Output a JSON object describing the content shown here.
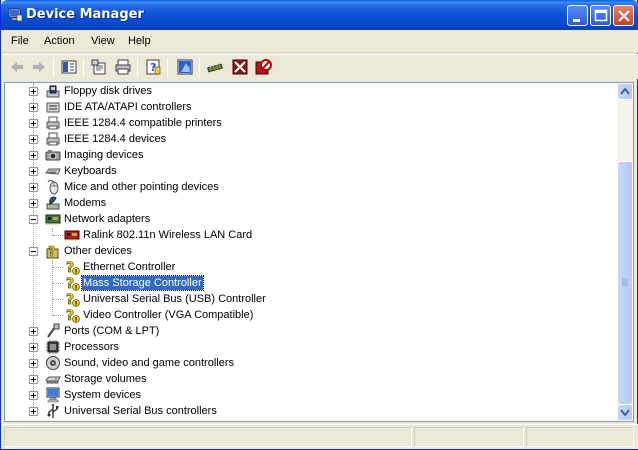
{
  "window": {
    "title": "Device Manager"
  },
  "title_buttons": {
    "minimize": "minimize",
    "maximize": "maximize",
    "close": "close"
  },
  "menu": [
    "File",
    "Action",
    "View",
    "Help"
  ],
  "toolbar": {
    "icons": [
      "back-icon",
      "forward-icon",
      "show-hide-console-tree-icon",
      "properties-icon",
      "print-icon",
      "help-icon",
      "computer-icon",
      "scan-hardware-icon",
      "uninstall-icon",
      "disable-icon"
    ]
  },
  "tree": {
    "items": [
      {
        "label": "Floppy disk drives",
        "icon": "floppy-icon",
        "level": 0,
        "expanded": false
      },
      {
        "label": "IDE ATA/ATAPI controllers",
        "icon": "ide-icon",
        "level": 0,
        "expanded": false
      },
      {
        "label": "IEEE 1284.4 compatible printers",
        "icon": "printer-icon",
        "level": 0,
        "expanded": false
      },
      {
        "label": "IEEE 1284.4 devices",
        "icon": "printer-icon",
        "level": 0,
        "expanded": false
      },
      {
        "label": "Imaging devices",
        "icon": "camera-icon",
        "level": 0,
        "expanded": false
      },
      {
        "label": "Keyboards",
        "icon": "keyboard-icon",
        "level": 0,
        "expanded": false
      },
      {
        "label": "Mice and other pointing devices",
        "icon": "mouse-icon",
        "level": 0,
        "expanded": false
      },
      {
        "label": "Modems",
        "icon": "modem-icon",
        "level": 0,
        "expanded": false
      },
      {
        "label": "Network adapters",
        "icon": "network-card-icon",
        "level": 0,
        "expanded": true
      },
      {
        "label": "Ralink 802.11n Wireless LAN Card",
        "icon": "network-card-icon",
        "level": 1
      },
      {
        "label": "Other devices",
        "icon": "unknown-device-icon",
        "level": 0,
        "expanded": true
      },
      {
        "label": "Ethernet Controller",
        "icon": "warning-unknown-icon",
        "level": 1
      },
      {
        "label": "Mass Storage Controller",
        "icon": "warning-unknown-icon",
        "level": 1,
        "selected": true
      },
      {
        "label": "Universal Serial Bus (USB) Controller",
        "icon": "warning-unknown-icon",
        "level": 1
      },
      {
        "label": "Video Controller (VGA Compatible)",
        "icon": "warning-unknown-icon",
        "level": 1
      },
      {
        "label": "Ports (COM & LPT)",
        "icon": "port-icon",
        "level": 0,
        "expanded": false
      },
      {
        "label": "Processors",
        "icon": "processor-icon",
        "level": 0,
        "expanded": false
      },
      {
        "label": "Sound, video and game controllers",
        "icon": "sound-icon",
        "level": 0,
        "expanded": false
      },
      {
        "label": "Storage volumes",
        "icon": "storage-icon",
        "level": 0,
        "expanded": false
      },
      {
        "label": "System devices",
        "icon": "system-icon",
        "level": 0,
        "expanded": false
      },
      {
        "label": "Universal Serial Bus controllers",
        "icon": "usb-icon",
        "level": 0,
        "expanded": false
      }
    ]
  },
  "colors": {
    "selection": "#316ac5",
    "titlebar": "#0a4fd8",
    "warning": "#f0d010"
  }
}
